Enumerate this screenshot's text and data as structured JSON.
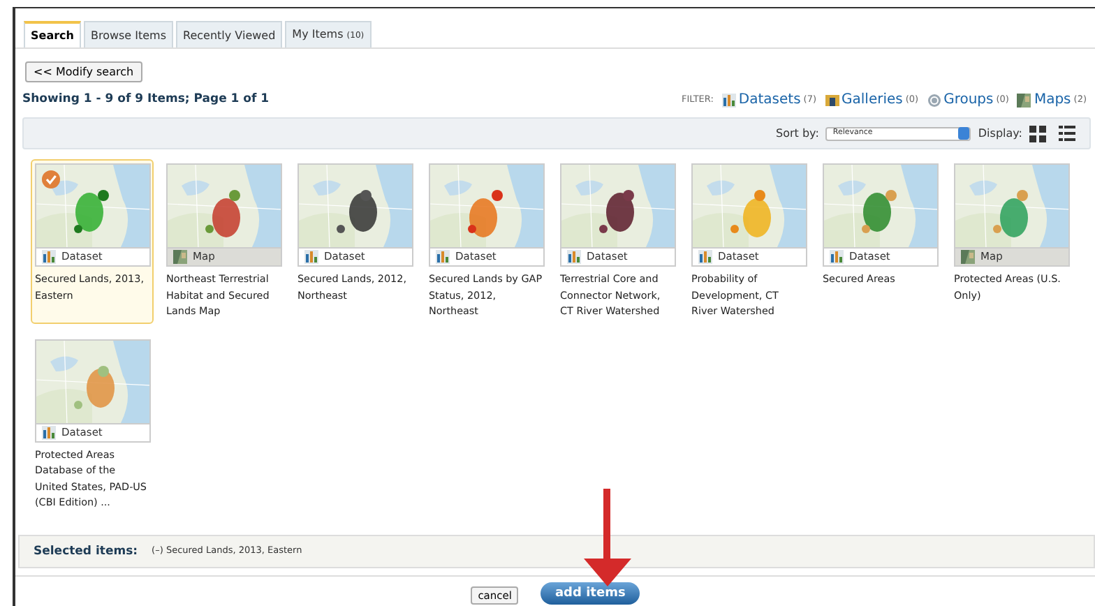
{
  "tabs": [
    {
      "label": "Search",
      "selected": true
    },
    {
      "label": "Browse Items",
      "selected": false
    },
    {
      "label": "Recently Viewed",
      "selected": false
    },
    {
      "label": "My Items",
      "count": "(10)",
      "selected": false
    }
  ],
  "modify_button": "<< Modify search",
  "results_summary": "Showing 1 - 9 of 9 Items; Page 1 of 1",
  "filter": {
    "label": "FILTER:",
    "items": [
      {
        "kind": "dataset",
        "label": "Datasets",
        "count": "(7)"
      },
      {
        "kind": "gallery",
        "label": "Galleries",
        "count": "(0)"
      },
      {
        "kind": "group",
        "label": "Groups",
        "count": "(0)"
      },
      {
        "kind": "map",
        "label": "Maps",
        "count": "(2)"
      }
    ]
  },
  "sort": {
    "label": "Sort by:",
    "value": "Relevance"
  },
  "display": {
    "label": "Display:"
  },
  "items": [
    {
      "kind": "dataset",
      "type": "Dataset",
      "title": "Secured Lands, 2013, Eastern",
      "selected": true
    },
    {
      "kind": "map",
      "type": "Map",
      "title": "Northeast Terrestrial Habitat and Secured Lands Map",
      "selected": false
    },
    {
      "kind": "dataset",
      "type": "Dataset",
      "title": "Secured Lands, 2012, Northeast",
      "selected": false
    },
    {
      "kind": "dataset",
      "type": "Dataset",
      "title": "Secured Lands by GAP Status, 2012, Northeast",
      "selected": false
    },
    {
      "kind": "dataset",
      "type": "Dataset",
      "title": "Terrestrial Core and Connector Network, CT River Watershed",
      "selected": false
    },
    {
      "kind": "dataset",
      "type": "Dataset",
      "title": "Probability of Development, CT River Watershed",
      "selected": false
    },
    {
      "kind": "dataset",
      "type": "Dataset",
      "title": "Secured Areas",
      "selected": false
    },
    {
      "kind": "map",
      "type": "Map",
      "title": "Protected Areas (U.S. Only)",
      "selected": false
    },
    {
      "kind": "dataset",
      "type": "Dataset",
      "title": "Protected Areas Database of the United States, PAD-US (CBI Edition) ...",
      "selected": false
    }
  ],
  "selected_items": {
    "label": "Selected items:",
    "entries": [
      {
        "remove": "(–)",
        "title": "Secured Lands, 2013, Eastern"
      }
    ]
  },
  "buttons": [
    {
      "kind": "secondary",
      "label": "cancel"
    },
    {
      "kind": "primary",
      "label": "add items"
    }
  ]
}
